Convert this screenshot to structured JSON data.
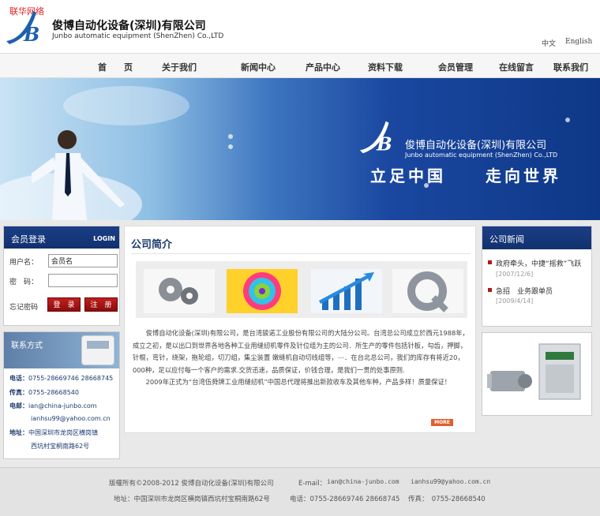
{
  "header": {
    "top_note": "联华网络",
    "company_cn": "俊博自动化设备(深圳)有限公司",
    "company_en": "Junbo automatic equipment (ShenZhen) Co.,LTD",
    "lang_zh": "中文",
    "lang_en": "English"
  },
  "nav": {
    "items": [
      "首　　页",
      "关于我们",
      "新闻中心",
      "产品中心",
      "资料下载",
      "会员管理",
      "在线留言",
      "联系我们"
    ]
  },
  "banner": {
    "company_cn": "俊博自动化设备(深圳)有限公司",
    "company_en": "Junbo automatic equipment (ShenZhen) Co.,LTD",
    "slogan_left": "立足中国",
    "slogan_right": "走向世界"
  },
  "login": {
    "title": "会员登录",
    "title_en": "LOGIN",
    "username_label": "用户名：",
    "username_value": "会员名",
    "password_label": "密　码：",
    "password_value": "",
    "forgot": "忘记密码",
    "login_button": "登　录",
    "register_button": "注　册"
  },
  "contact": {
    "title": "联系方式",
    "phone_label": "电话：",
    "phone": "0755-28669746 28668745",
    "fax_label": "传真：",
    "fax": "0755-28668540",
    "email_label": "电邮：",
    "email1": "ian@china-junbo.com",
    "email2": "ianhsu99@yahoo.com.cn",
    "address_label": "地址：",
    "address1": "中国深圳市龙岗区横岗镇",
    "address2": "西坑村宝桐南路62号"
  },
  "intro": {
    "title": "公司简介",
    "paragraph1": "　　俊博自动化设备(深圳)有限公司，是台湾骏诺工业股份有限公司的大陆分公司。台湾总公司成立於西元1988年，成立之初，是以出口到世界各地各种工业用缝纫机零件及针位组为主的公司．所生产的零件包括针板，勾齿，押脚，针棍，弯针，绕架，拖轮组，切刀组，集尘装置 嫩缝机自动切线组等，⋯．在台北总公司，我们的库存有将近20，000种，足以应付每一个客户的需求.交货迅速，品质保证，价钱合理，是我们一贯的处事原则.",
    "paragraph2": "　　2009年正式为“台湾伍舜牌工业用缝纫机”中国总代理将推出新款收车及其他车种，产品多样！质量保证！",
    "more": "MORE"
  },
  "news": {
    "title": "公司新闻",
    "items": [
      {
        "title": "政府牵头，中捷“摇救”飞跃",
        "date": "[2007/12/6]"
      },
      {
        "title": "急招　业务跟单员",
        "date": "[2009/4/14]"
      }
    ]
  },
  "footer": {
    "copyright": "版權所有©2008-2012 俊博自动化设备(深圳)有限公司",
    "email_label": "E-mail：",
    "email1": "ian@china-junbo.com",
    "email2": "ianhsu99@yahoo.com.cn",
    "address": "地址：中国深圳市龙岗区横岗镇西坑村宝桐南路62号",
    "phone": "电话：0755-28669746 28668745",
    "fax": "传真：　0755-28668540"
  },
  "colors": {
    "brand_blue": "#1b3f86",
    "button_red": "#a91c1c"
  }
}
